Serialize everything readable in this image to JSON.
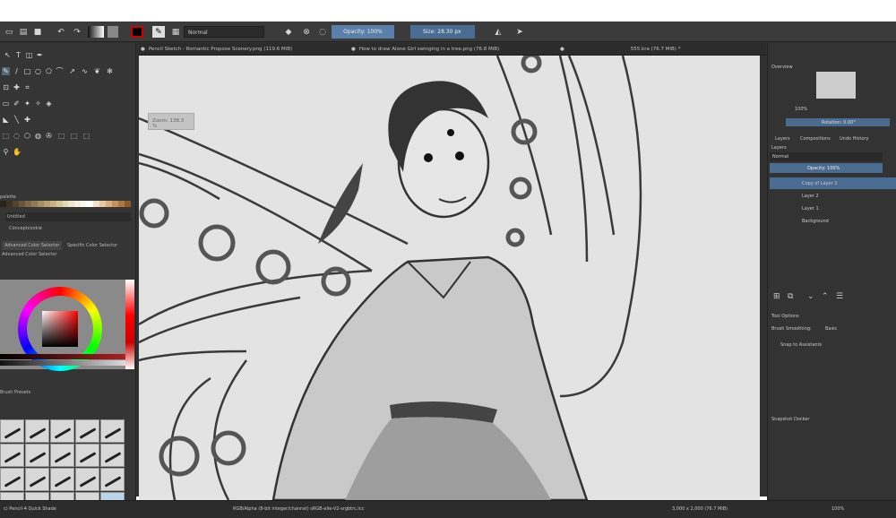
{
  "toolbar": {
    "blend_mode": "Normal",
    "opacity": "Opacity: 100%",
    "size": "Size: 28.30 px"
  },
  "tabs": [
    {
      "title": "Pencil Sketch - Romantic Propose Scenery.png (119.6 MiB)"
    },
    {
      "title": "How to draw Alone Girl swinging in a tree.png (76.8 MiB)"
    },
    {
      "title": "555.kra (76.7 MiB) *"
    }
  ],
  "left": {
    "palette_label": "palette",
    "untitled": "Untitled",
    "conceptcookie": "Conceptcookie",
    "tab_advanced": "Advanced Color Selector",
    "tab_specific": "Specific Color Selector",
    "advanced_label": "Advanced Color Selector",
    "brush_presets": "Brush Presets",
    "preset_name": "c) Pencil-4 Quick Shade",
    "colors": {
      "swatch": [
        "#2a2418",
        "#3d3323",
        "#51432d",
        "#6a5637",
        "#7d6a46",
        "#8f7b52",
        "#a48d61",
        "#b8a06f",
        "#c8b283",
        "#d7c699",
        "#e4d7b3",
        "#efe6cf",
        "#f5f0e0",
        "#fbf8f0",
        "#ffffff",
        "#f4e1c8",
        "#e8c9a3",
        "#d8ae80",
        "#c4925f",
        "#ad7741",
        "#8e5c2c"
      ]
    }
  },
  "canvas": {
    "zoom": "Zoom: 138.3 %"
  },
  "right": {
    "overview": "Overview",
    "zoom_pct": "100%",
    "rotation": "Rotation: 0.00°",
    "tab_layers": "Layers",
    "tab_compositions": "Compositions",
    "tab_undo": "Undo History",
    "layers_label": "Layers",
    "layer_blend": "Normal",
    "layer_opacity": "Opacity: 100%",
    "layers": [
      {
        "name": "Copy of Layer 2"
      },
      {
        "name": "Layer 2"
      },
      {
        "name": "Layer 1"
      },
      {
        "name": "Background"
      }
    ],
    "tool_options": "Tool Options",
    "brush_smoothing": "Brush Smoothing:",
    "smoothing_value": "Basic",
    "snap_assistants": "Snap to Assistants",
    "snapshot_docker": "Snapshot Docker"
  },
  "status": {
    "color_profile": "RGB/Alpha (8-bit integer/channel)  sRGB-elle-V2-srgbtrc.icc",
    "dimensions": "3,000 x 2,000 (76.7 MiB)",
    "zoom": "100%"
  }
}
